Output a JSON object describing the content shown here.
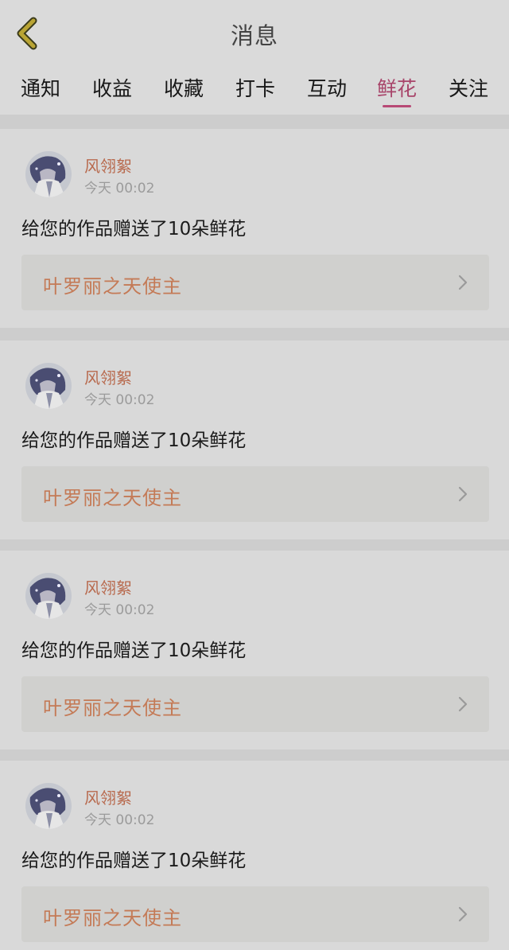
{
  "header": {
    "title": "消息"
  },
  "tabs": [
    {
      "label": "通知"
    },
    {
      "label": "收益"
    },
    {
      "label": "收藏"
    },
    {
      "label": "打卡"
    },
    {
      "label": "互动"
    },
    {
      "label": "鲜花",
      "active": true
    },
    {
      "label": "关注"
    }
  ],
  "messages": [
    {
      "sender": "风翎絮",
      "time": "今天 00:02",
      "text": "给您的作品赠送了10朵鲜花",
      "work_title": "叶罗丽之天使主"
    },
    {
      "sender": "风翎絮",
      "time": "今天 00:02",
      "text": "给您的作品赠送了10朵鲜花",
      "work_title": "叶罗丽之天使主"
    },
    {
      "sender": "风翎絮",
      "time": "今天 00:02",
      "text": "给您的作品赠送了10朵鲜花",
      "work_title": "叶罗丽之天使主"
    },
    {
      "sender": "风翎絮",
      "time": "今天 00:02",
      "text": "给您的作品赠送了10朵鲜花",
      "work_title": "叶罗丽之天使主"
    }
  ],
  "colors": {
    "accent_tab": "#a8456a",
    "sender_name": "#b86a4e",
    "work_title": "#c47a56",
    "back_icon": "#b9a434"
  },
  "icons": {
    "back": "back-arrow-icon",
    "chevron": "chevron-right-icon"
  }
}
